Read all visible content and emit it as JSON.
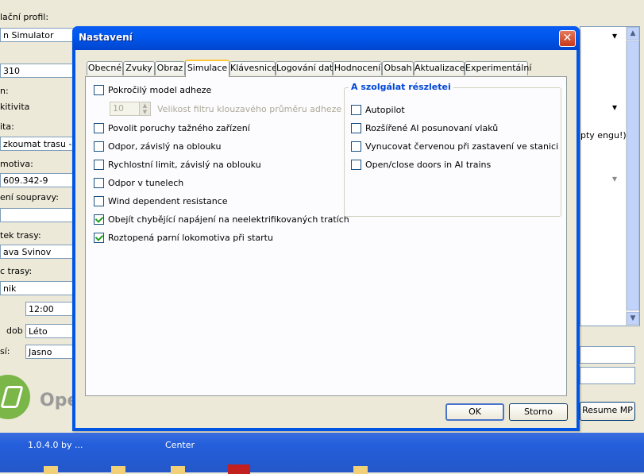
{
  "background_app": {
    "labels": [
      "lační profil:",
      "n:",
      "kitivita",
      "ita:",
      "motiva:",
      "ení soupravy:",
      "tek trasy:",
      "c trasy:",
      "dob",
      "sí:"
    ],
    "profile_value": "n Simulator",
    "field_310": "310",
    "activity_value": "zkoumat trasu -",
    "loco_value": "609.342-9",
    "start_value": "ava Svinov",
    "end_value": "nik",
    "time_value": "12:00",
    "season_label": "dob",
    "season_value": "Léto",
    "weather_value": "Jasno",
    "right_text": "pty engu!)",
    "resume_label": "Resume MP",
    "logo_text": "Ope",
    "version_text": "1.0.4.0 by ...",
    "center_text": "Center"
  },
  "dialog": {
    "title": "Nastavení",
    "tabs": [
      {
        "label": "Obecné"
      },
      {
        "label": "Zvuky"
      },
      {
        "label": "Obraz"
      },
      {
        "label": "Simulace",
        "active": true
      },
      {
        "label": "Klávesnice"
      },
      {
        "label": "Logování dat"
      },
      {
        "label": "Hodnocení"
      },
      {
        "label": "Obsah"
      },
      {
        "label": "Aktualizace"
      },
      {
        "label": "Experimentální"
      }
    ],
    "left_options": [
      {
        "label": "Pokročilý model adheze",
        "checked": false
      },
      {
        "label": "Povolit poruchy tažného zařízení",
        "checked": false
      },
      {
        "label": "Odpor, závislý na oblouku",
        "checked": false
      },
      {
        "label": "Rychlostní limit, závislý na oblouku",
        "checked": false
      },
      {
        "label": "Odpor v tunelech",
        "checked": false
      },
      {
        "label": "Wind dependent resistance",
        "checked": false
      },
      {
        "label": "Obejít chybějící napájení na neelektrifikovaných tratích",
        "checked": true
      },
      {
        "label": "Roztopená parní lokomotiva při startu",
        "checked": true
      }
    ],
    "adhesion_filter": {
      "value": "10",
      "label": "Velikost filtru klouzavého průměru adheze"
    },
    "group": {
      "title": "A szolgálat részletei",
      "options": [
        {
          "label": "Autopilot",
          "checked": false
        },
        {
          "label": "Rozšířené AI posunovaní vlaků",
          "checked": false
        },
        {
          "label": "Vynucovat červenou při zastavení ve stanici",
          "checked": false
        },
        {
          "label": "Open/close doors in AI trains",
          "checked": false
        }
      ]
    },
    "ok_label": "OK",
    "cancel_label": "Storno"
  }
}
